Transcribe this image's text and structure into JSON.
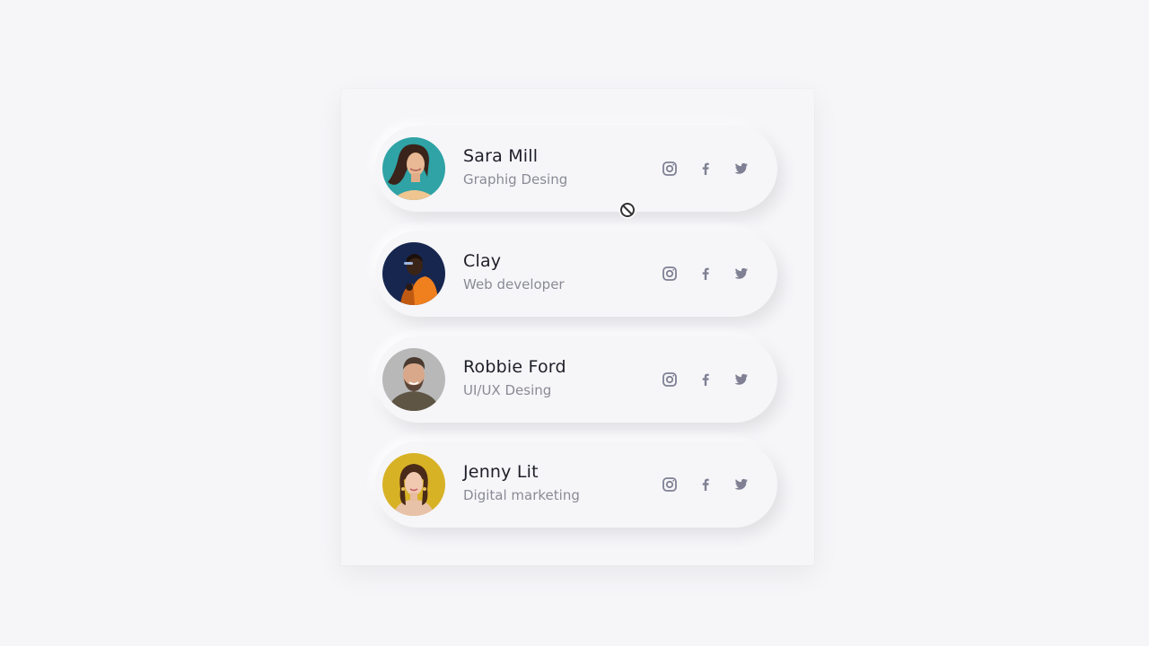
{
  "team": [
    {
      "name": "Sara Mill",
      "role": "Graphig Desing",
      "avatar": "woman-teal-background"
    },
    {
      "name": "Clay",
      "role": "Web developer",
      "avatar": "man-dark-blue-background"
    },
    {
      "name": "Robbie Ford",
      "role": "UI/UX Desing",
      "avatar": "bearded-man-gray-background"
    },
    {
      "name": "Jenny Lit",
      "role": "Digital marketing",
      "avatar": "woman-yellow-background"
    }
  ],
  "icons": {
    "instagram": "instagram-icon",
    "facebook": "facebook-icon",
    "twitter": "twitter-icon",
    "cursor": "not-allowed-cursor"
  },
  "colors": {
    "background": "#f6f6f9",
    "name_text": "#1e1e28",
    "role_text": "#8a8a96",
    "social_icon": "#7f8094"
  }
}
